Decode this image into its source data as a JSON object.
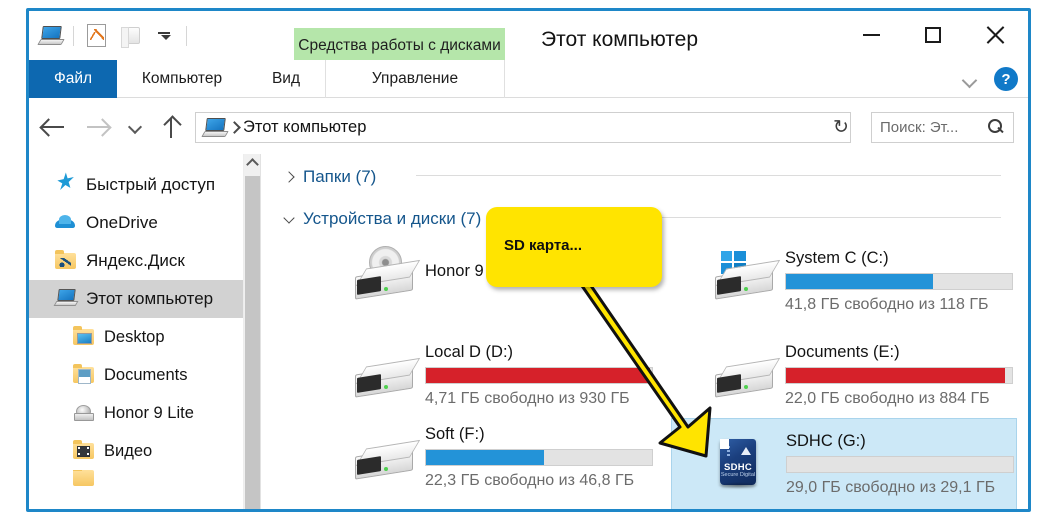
{
  "window": {
    "title": "Этот компьютер",
    "controls": {
      "minimize": "—",
      "maximize": "□",
      "close": "✕"
    }
  },
  "quick_access_toolbar": {
    "items": [
      {
        "name": "this-pc-icon",
        "label": "Этот компьютер"
      },
      {
        "name": "properties-icon",
        "label": "Свойства"
      },
      {
        "name": "new-folder-icon",
        "label": "Создать папку"
      },
      {
        "name": "customize-dropdown-icon",
        "label": "Настроить панель быстрого доступа"
      }
    ]
  },
  "ribbon": {
    "contextual_tab_group": "Средства работы с дисками",
    "tabs": [
      {
        "id": "file",
        "label": "Файл",
        "active": true
      },
      {
        "id": "computer",
        "label": "Компьютер",
        "active": false
      },
      {
        "id": "view",
        "label": "Вид",
        "active": false
      },
      {
        "id": "manage",
        "label": "Управление",
        "active": false
      }
    ],
    "collapse_label": "Свернуть ленту",
    "help_label": "?"
  },
  "addressbar": {
    "back": "←",
    "forward": "→",
    "recent": "⌄",
    "up": "↑",
    "breadcrumb": "Этот компьютер",
    "dropdown": "⌄",
    "refresh": "↻",
    "search_placeholder": "Поиск: Эт...",
    "search_value": ""
  },
  "sidebar": {
    "items": [
      {
        "label": "Быстрый доступ",
        "icon": "star-icon",
        "indent": false,
        "selected": false
      },
      {
        "label": "OneDrive",
        "icon": "cloud-icon",
        "indent": false,
        "selected": false
      },
      {
        "label": "Яндекс.Диск",
        "icon": "yandex-disk-folder-icon",
        "indent": false,
        "selected": false
      },
      {
        "label": "Этот компьютер",
        "icon": "this-pc-icon",
        "indent": false,
        "selected": true
      },
      {
        "label": "Desktop",
        "icon": "desktop-folder-icon",
        "indent": true,
        "selected": false
      },
      {
        "label": "Documents",
        "icon": "documents-folder-icon",
        "indent": true,
        "selected": false
      },
      {
        "label": "Honor 9 Lite",
        "icon": "phone-device-icon",
        "indent": true,
        "selected": false
      },
      {
        "label": "Видео",
        "icon": "video-folder-icon",
        "indent": true,
        "selected": false
      }
    ]
  },
  "content": {
    "groups": [
      {
        "label": "Папки (7)",
        "expanded": false
      },
      {
        "label": "Устройства и диски (7)",
        "expanded": true
      }
    ],
    "drives": [
      {
        "name": "Honor 9 Lite",
        "icon": "optical-drive-icon",
        "has_bar": false,
        "free_text": "",
        "fill_percent": 0,
        "fill_color": "",
        "selected": false
      },
      {
        "name": "System C (C:)",
        "icon": "windows-system-drive-icon",
        "has_bar": true,
        "free_text": "41,8 ГБ свободно из 118 ГБ",
        "fill_percent": 65,
        "fill_color": "#2393d8",
        "selected": false
      },
      {
        "name": "Local D (D:)",
        "icon": "hard-drive-icon",
        "has_bar": true,
        "free_text": "4,71 ГБ свободно из 930 ГБ",
        "fill_percent": 99,
        "fill_color": "#d6212a",
        "selected": false
      },
      {
        "name": "Documents (E:)",
        "icon": "hard-drive-icon",
        "has_bar": true,
        "free_text": "22,0 ГБ свободно из 884 ГБ",
        "fill_percent": 97,
        "fill_color": "#d6212a",
        "selected": false
      },
      {
        "name": "Soft (F:)",
        "icon": "hard-drive-icon",
        "has_bar": true,
        "free_text": "22,3 ГБ свободно из 46,8 ГБ",
        "fill_percent": 52,
        "fill_color": "#2393d8",
        "selected": false
      },
      {
        "name": "SDHC (G:)",
        "icon": "sd-card-icon",
        "has_bar": true,
        "free_text": "29,0 ГБ свободно из 29,1 ГБ",
        "fill_percent": 0,
        "fill_color": "#2393d8",
        "selected": true
      }
    ]
  },
  "sd_card_icon": {
    "label": "SDHC",
    "sublabel": "Secure Digital"
  },
  "annotation": {
    "callout_text": "SD карта...",
    "callout_color": "#ffe400",
    "arrow_color": "#ffe400"
  },
  "colors": {
    "window_border": "#1e87c8",
    "file_tab": "#0d68b0",
    "contextual_tab": "#b5e6aa",
    "selection": "#cce8f7",
    "group_header": "#15568c"
  }
}
